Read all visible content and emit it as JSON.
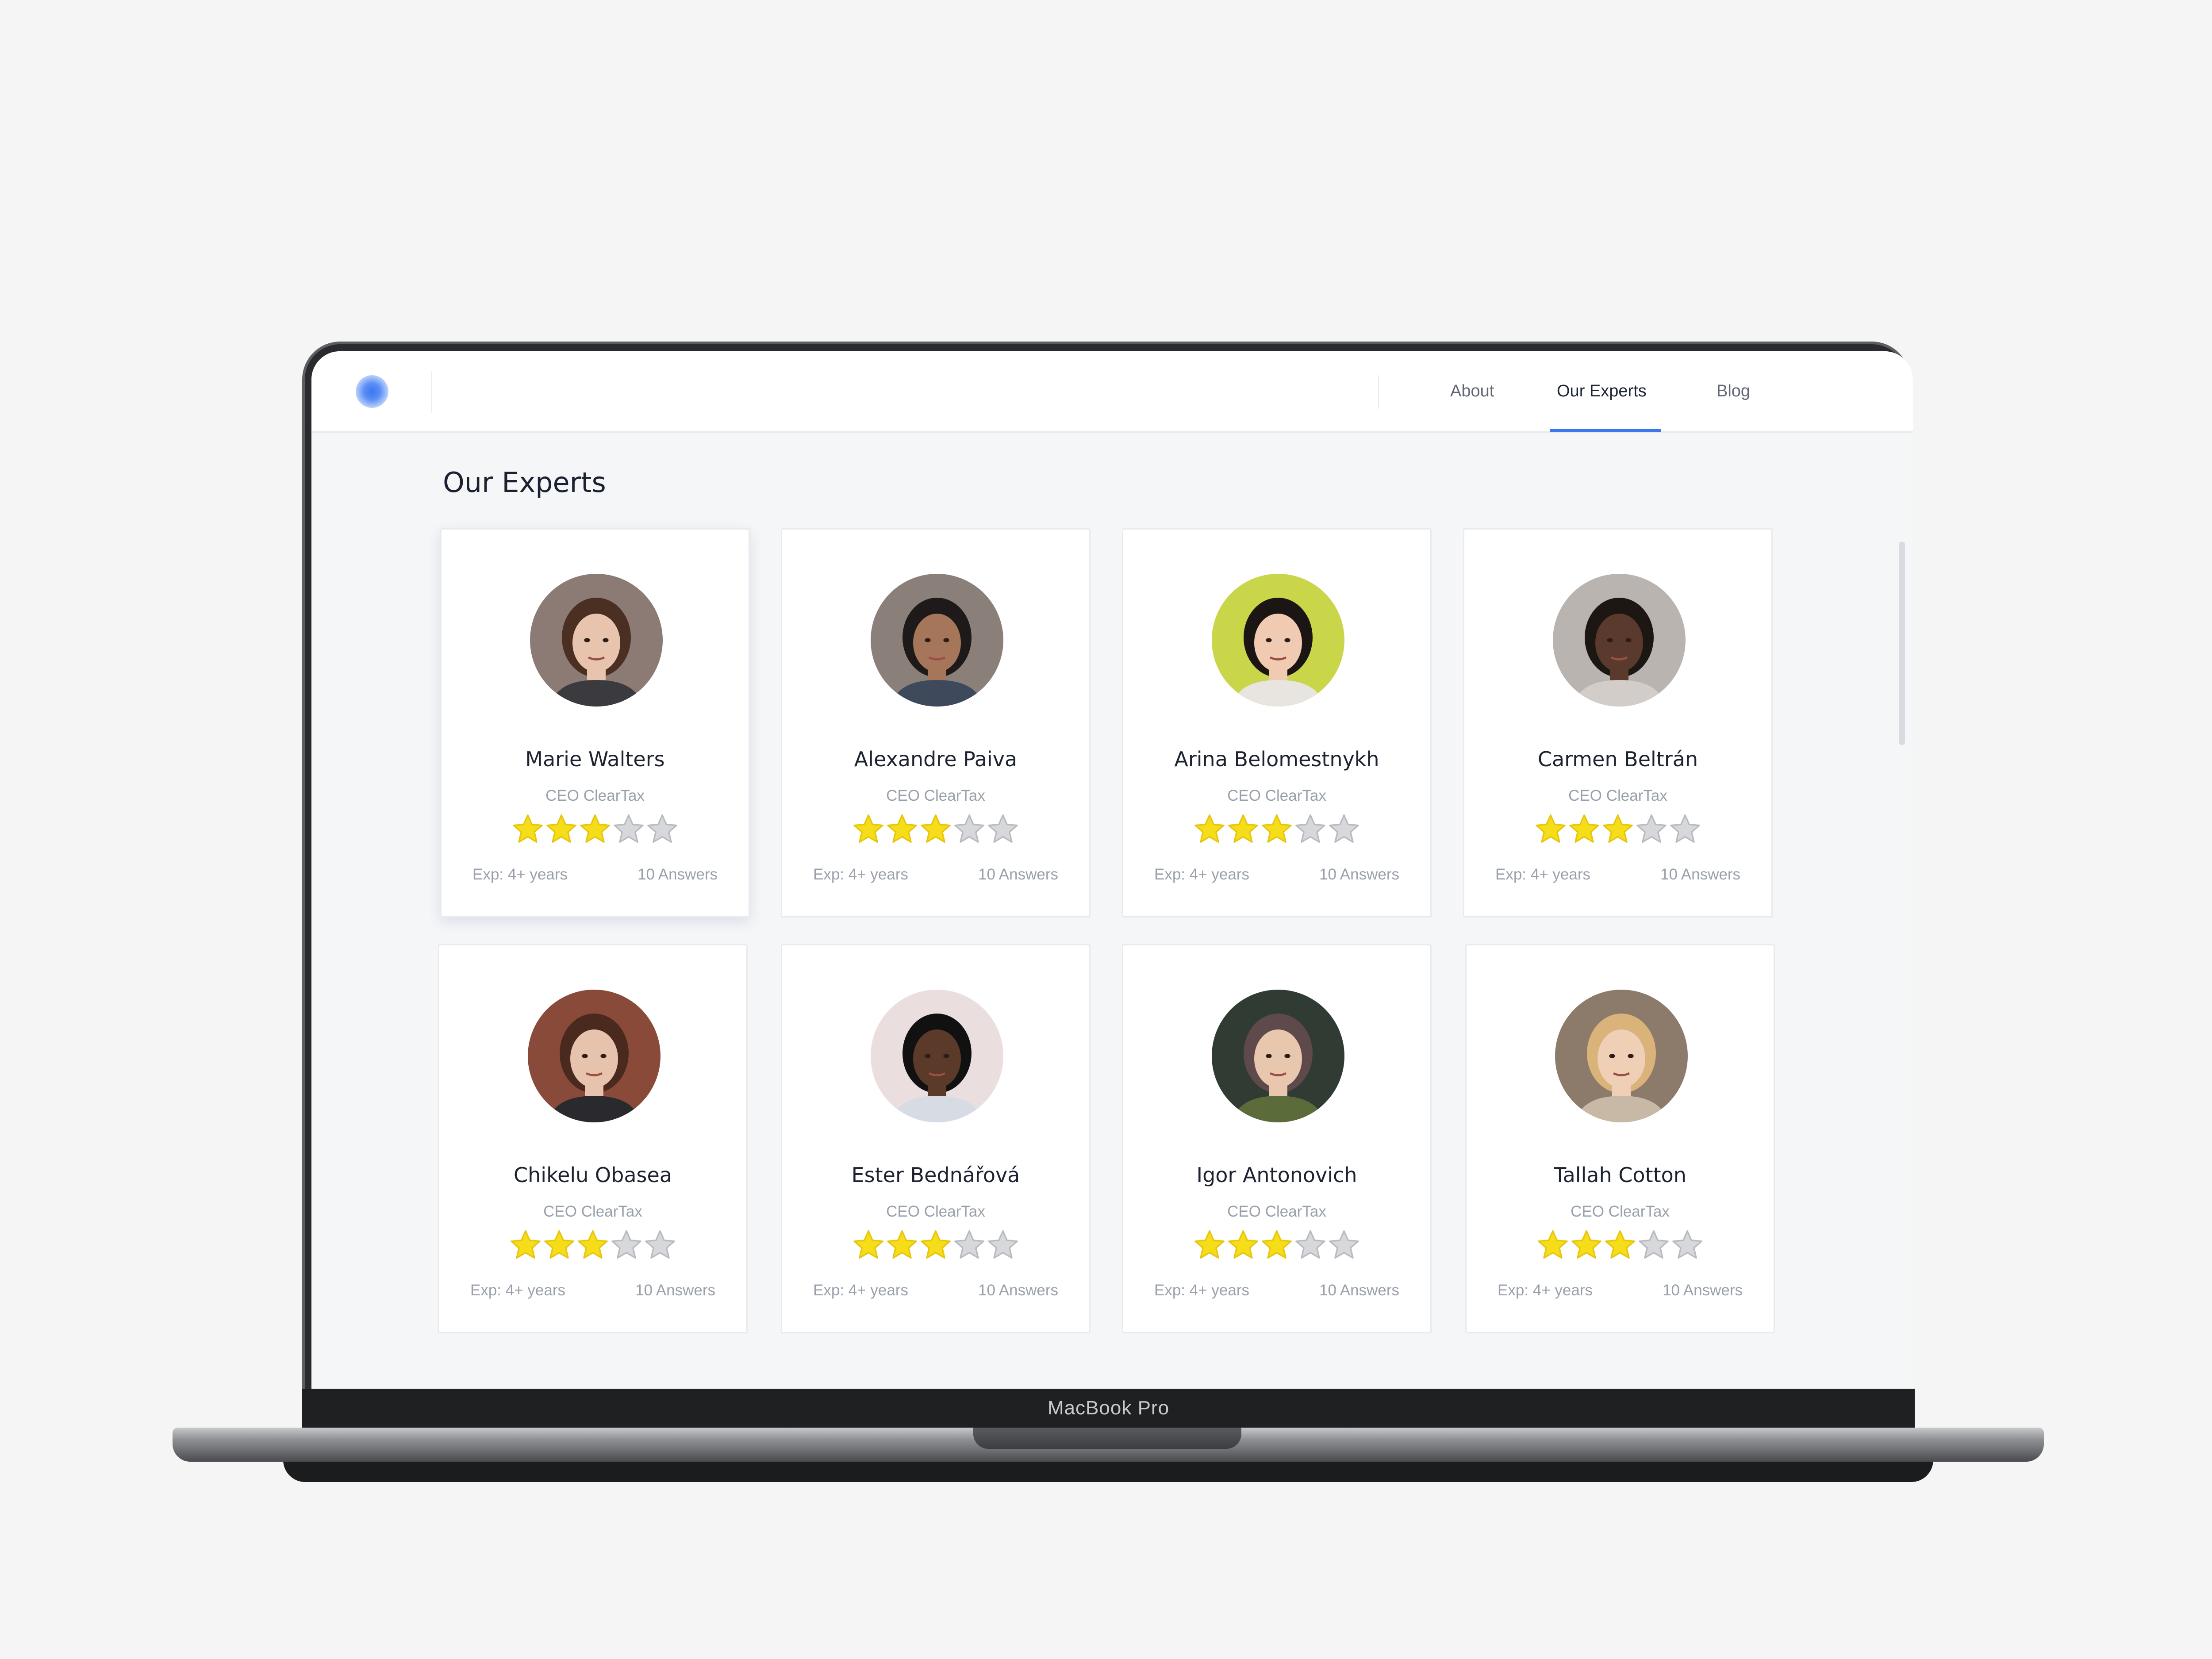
{
  "device": {
    "brand_label": "MacBook Pro"
  },
  "nav": {
    "tabs": [
      {
        "label": "About",
        "active": false
      },
      {
        "label": "Our Experts",
        "active": true
      },
      {
        "label": "Blog",
        "active": false
      }
    ],
    "accent_color": "#3c77f0"
  },
  "page": {
    "title": "Our Experts"
  },
  "experts": [
    {
      "name": "Marie Walters",
      "role": "CEO ClearTax",
      "rating": 3,
      "rating_max": 5,
      "experience": "Exp: 4+ years",
      "answers": "10 Answers",
      "avatar": "photo-woman-brown-hair"
    },
    {
      "name": "Alexandre Paiva",
      "role": "CEO ClearTax",
      "rating": 3,
      "rating_max": 5,
      "experience": "Exp: 4+ years",
      "answers": "10 Answers",
      "avatar": "photo-woman-profile-hair-bun"
    },
    {
      "name": "Arina Belomestnykh",
      "role": "CEO ClearTax",
      "rating": 3,
      "rating_max": 5,
      "experience": "Exp: 4+ years",
      "answers": "10 Answers",
      "avatar": "photo-woman-smiling-green-bg"
    },
    {
      "name": "Carmen Beltrán",
      "role": "CEO ClearTax",
      "rating": 3,
      "rating_max": 5,
      "experience": "Exp: 4+ years",
      "answers": "10 Answers",
      "avatar": "photo-woman-looking-up"
    },
    {
      "name": "Chikelu Obasea",
      "role": "CEO ClearTax",
      "rating": 3,
      "rating_max": 5,
      "experience": "Exp: 4+ years",
      "answers": "10 Answers",
      "avatar": "photo-woman-brick-bg"
    },
    {
      "name": "Ester Bednářová",
      "role": "CEO ClearTax",
      "rating": 3,
      "rating_max": 5,
      "experience": "Exp: 4+ years",
      "answers": "10 Answers",
      "avatar": "photo-man-black-cap"
    },
    {
      "name": "Igor Antonovich",
      "role": "CEO ClearTax",
      "rating": 3,
      "rating_max": 5,
      "experience": "Exp: 4+ years",
      "answers": "10 Answers",
      "avatar": "photo-woman-glasses"
    },
    {
      "name": "Tallah Cotton",
      "role": "CEO ClearTax",
      "rating": 3,
      "rating_max": 5,
      "experience": "Exp: 4+ years",
      "answers": "10 Answers",
      "avatar": "photo-woman-blonde-smiling"
    }
  ],
  "colors": {
    "star_filled": "#f5dd1a",
    "star_empty": "#d7d8dc"
  }
}
